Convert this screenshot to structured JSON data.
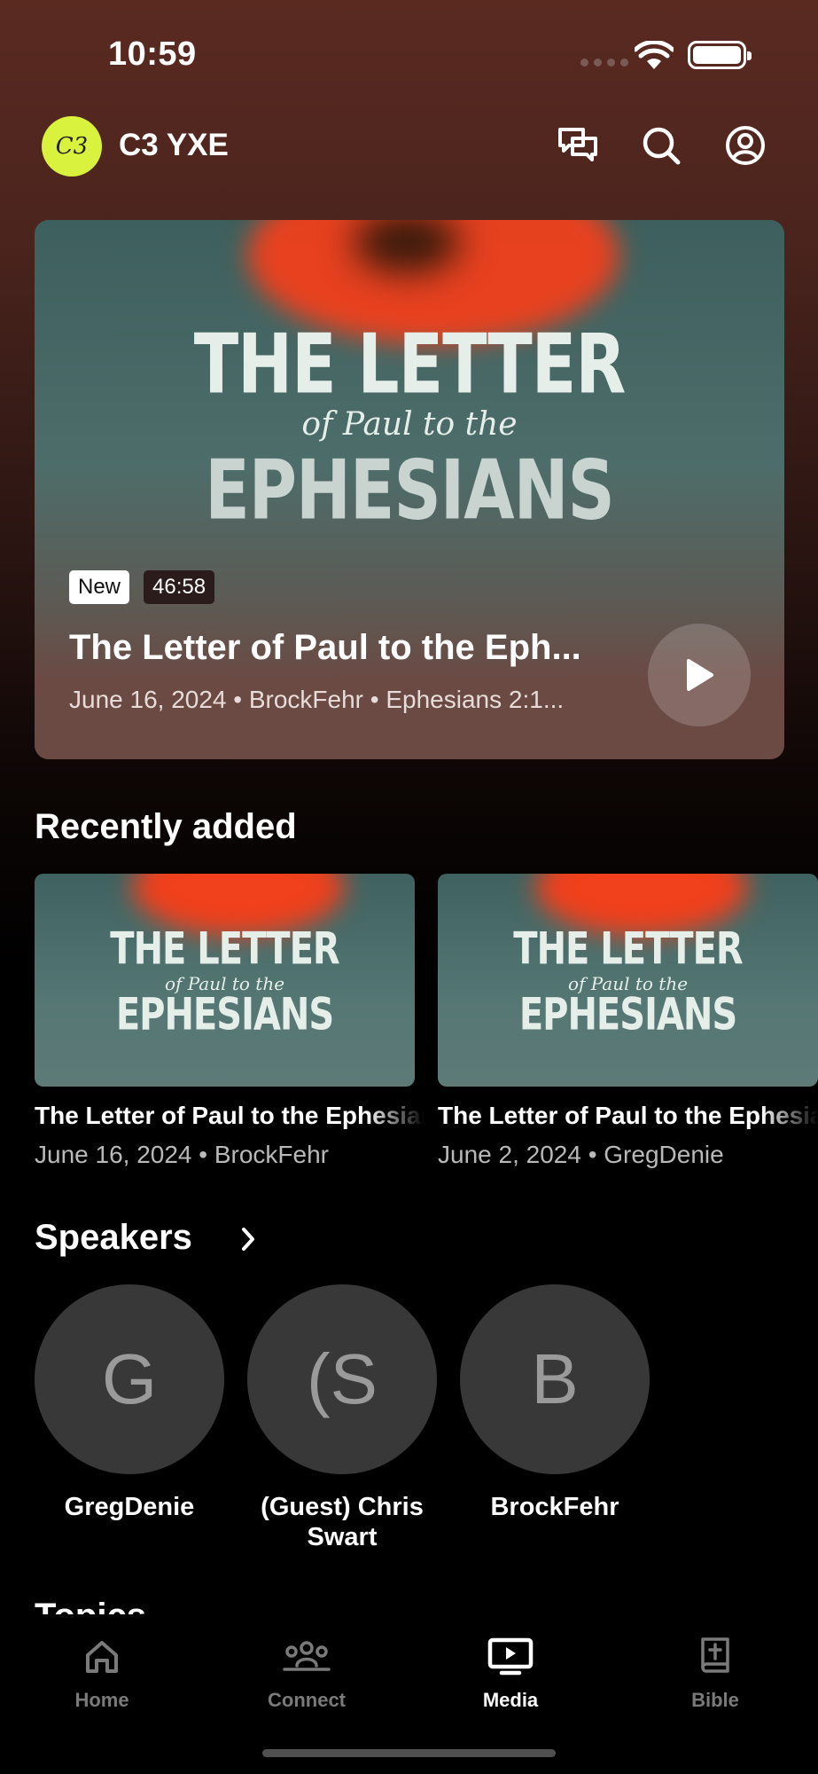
{
  "status_bar": {
    "time": "10:59"
  },
  "header": {
    "logo_text": "C3",
    "title": "C3 YXE",
    "icons": [
      "chat-icon",
      "search-icon",
      "account-icon"
    ]
  },
  "hero": {
    "artwork": {
      "line1": "THE LETTER",
      "line2": "of Paul to the",
      "line3": "EPHESIANS"
    },
    "badge_new": "New",
    "duration": "46:58",
    "title": "The Letter of Paul to the Eph...",
    "meta": "June 16, 2024 • BrockFehr • Ephesians 2:1..."
  },
  "recently_added": {
    "heading": "Recently added",
    "items": [
      {
        "title": "The Letter of Paul to the Ephesians",
        "meta": "June 16, 2024 • BrockFehr",
        "art": {
          "line1": "THE LETTER",
          "line2": "of Paul to the",
          "line3": "EPHESIANS"
        }
      },
      {
        "title": "The Letter of Paul to the Ephesians",
        "meta": "June 2, 2024 • GregDenie",
        "art": {
          "line1": "THE LETTER",
          "line2": "of Paul to the",
          "line3": "EPHESIANS"
        }
      }
    ]
  },
  "speakers": {
    "heading": "Speakers",
    "items": [
      {
        "initial": "G",
        "name": "GregDenie"
      },
      {
        "initial": "(S",
        "name": "(Guest) Chris Swart"
      },
      {
        "initial": "B",
        "name": "BrockFehr"
      }
    ]
  },
  "topics": {
    "heading": "Topics"
  },
  "tabbar": {
    "tabs": [
      {
        "label": "Home",
        "icon": "home-icon",
        "active": false
      },
      {
        "label": "Connect",
        "icon": "people-icon",
        "active": false
      },
      {
        "label": "Media",
        "icon": "tv-play-icon",
        "active": true
      },
      {
        "label": "Bible",
        "icon": "bible-icon",
        "active": false
      }
    ]
  }
}
